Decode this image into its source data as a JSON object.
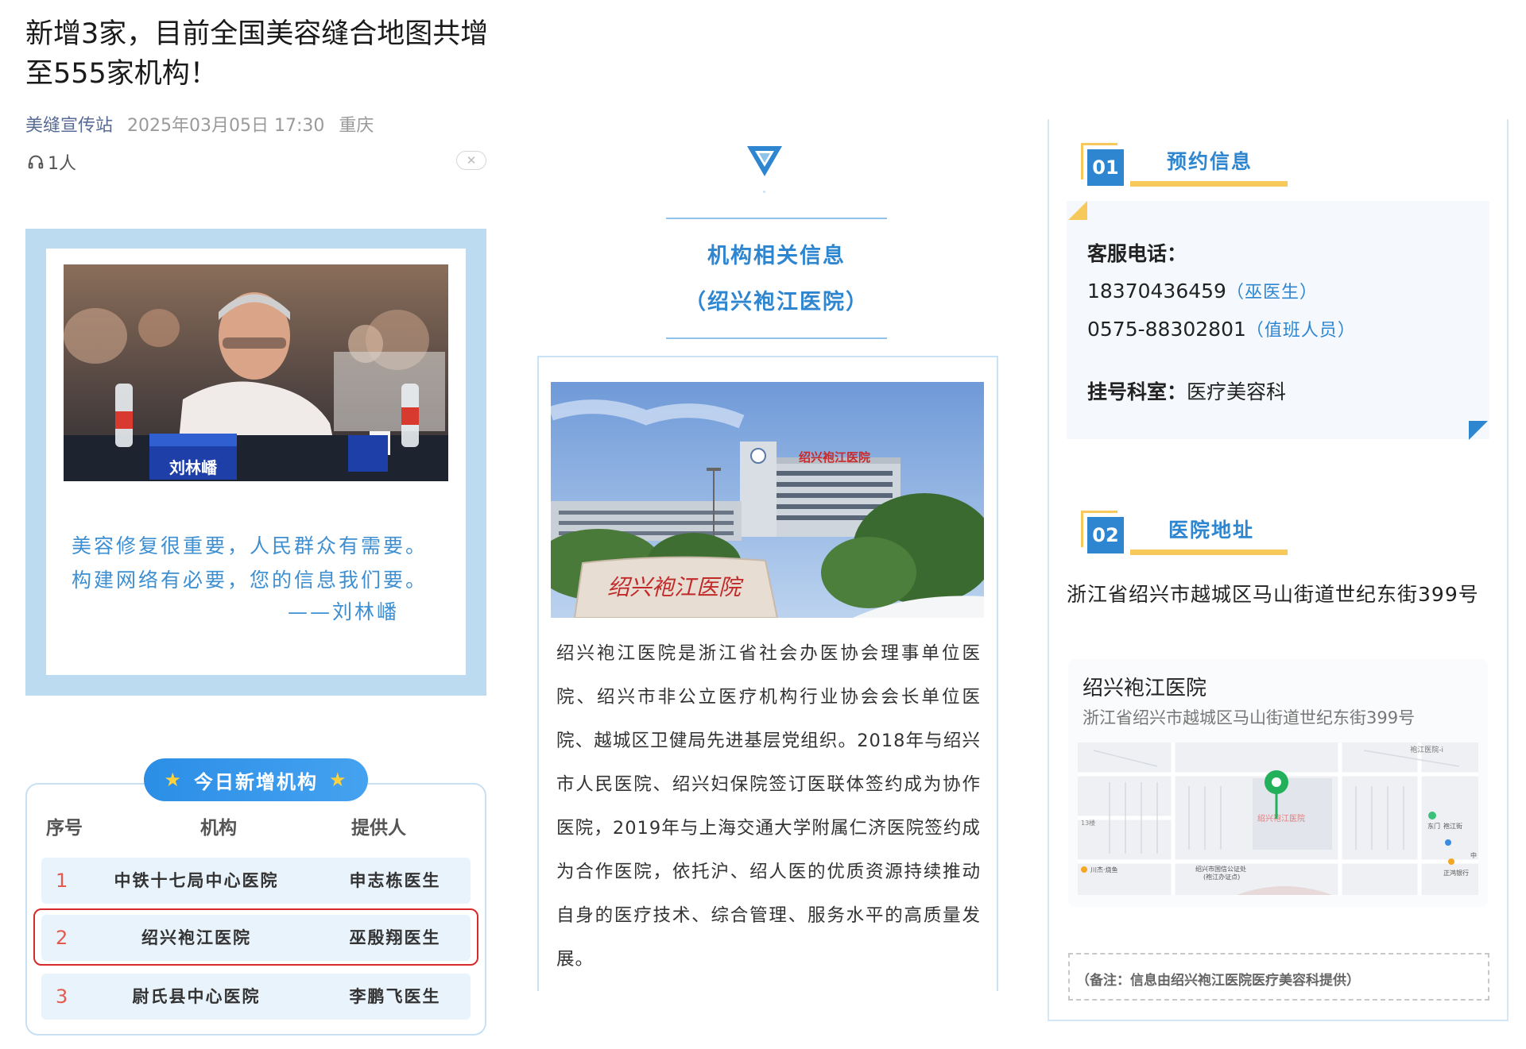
{
  "article": {
    "title": "新增3家，目前全国美容缝合地图共增至555家机构！",
    "source": "美缝宣传站",
    "datetime": "2025年03月05日 17:30",
    "location": "重庆",
    "listeners": "1人"
  },
  "quote": {
    "badge_name": "刘林嶓",
    "line1": "美容修复很重要，人民群众有需要。",
    "line2": "构建网络有必要，您的信息我们要。",
    "attribution": "——刘林嶓"
  },
  "new_institutions": {
    "pill_label": "今日新增机构",
    "headers": [
      "序号",
      "机构",
      "提供人"
    ],
    "rows": [
      {
        "num": "1",
        "org": "中铁十七局中心医院",
        "provider": "申志栋医生"
      },
      {
        "num": "2",
        "org": "绍兴袍江医院",
        "provider": "巫殷翔医生"
      },
      {
        "num": "3",
        "org": "尉氏县中心医院",
        "provider": "李鹏飞医生"
      }
    ]
  },
  "institution_info": {
    "title": "机构相关信息",
    "subtitle": "（绍兴袍江医院）",
    "photo_sign_building": "绍兴袍江医院",
    "photo_sign_stone": "绍兴袍江医院",
    "description": "绍兴袍江医院是浙江省社会办医协会理事单位医院、绍兴市非公立医疗机构行业协会会长单位医院、越城区卫健局先进基层党组织。2018年与绍兴市人民医院、绍兴妇保院签订医联体签约成为协作医院，2019年与上海交通大学附属仁济医院签约成为合作医院，依托沪、绍人医的优质资源持续推动自身的医疗技术、综合管理、服务水平的高质量发展。"
  },
  "appointment": {
    "num": "01",
    "title": "预约信息",
    "phone_label": "客服电话：",
    "phone1": "18370436459",
    "phone1_note": "（巫医生）",
    "phone2": "0575-88302801",
    "phone2_note": "（值班人员）",
    "dept_label": "挂号科室：",
    "dept": "医疗美容科"
  },
  "address": {
    "num": "02",
    "title": "医院地址",
    "text": "浙江省绍兴市越城区马山街道世纪东街399号",
    "map_name": "绍兴袍江医院",
    "map_addr": "浙江省绍兴市越城区马山街道世纪东街399号",
    "map_labels": {
      "top_right": "袍江医院-i",
      "marker": "绍兴袍江医院",
      "left": "13楼",
      "door": "东门",
      "right": "袍江街",
      "bottom_left": "川杰·烧鱼",
      "bottom_mid": "绍兴市国信公证处",
      "bottom_mid2": "(袍江办证点)",
      "bottom_right": "正鸿银行",
      "far_right": "中"
    }
  },
  "footnote": "（备注：信息由绍兴袍江医院医疗美容科提供）",
  "colors": {
    "accent_blue": "#2f86d0",
    "gold": "#f6c95a",
    "highlight_red": "#d82a2a",
    "frame_blue": "#bcdaf0"
  }
}
